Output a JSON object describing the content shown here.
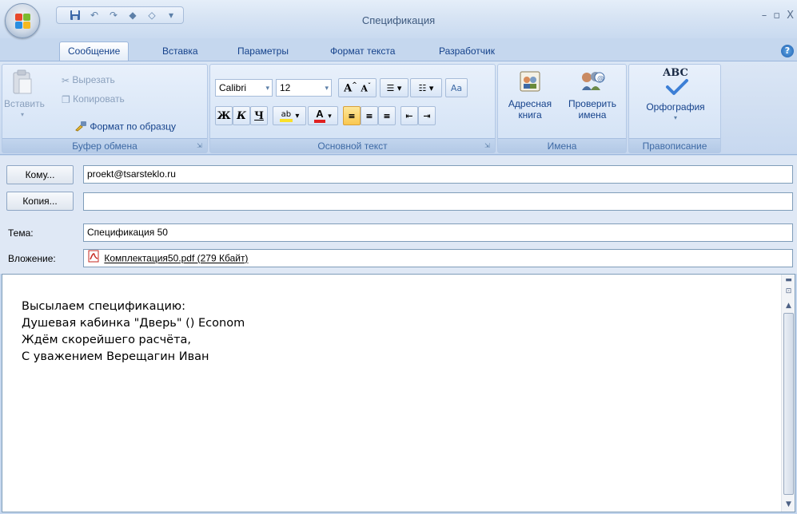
{
  "window": {
    "title": "Спецификация",
    "controls": [
      "–",
      "▫",
      "X"
    ]
  },
  "tabs": [
    {
      "label": "Сообщение",
      "active": true
    },
    {
      "label": "Вставка",
      "active": false
    },
    {
      "label": "Параметры",
      "active": false
    },
    {
      "label": "Формат текста",
      "active": false
    },
    {
      "label": "Разработчик",
      "active": false
    }
  ],
  "ribbon": {
    "clipboard": {
      "label": "Буфер обмена",
      "paste": "Вставить",
      "cut": "Вырезать",
      "copy": "Копировать",
      "format_painter": "Формат по образцу"
    },
    "basic_text": {
      "label": "Основной текст",
      "font_name": "Calibri",
      "font_size": "12",
      "bold": "Ж",
      "italic": "К",
      "underline": "Ч"
    },
    "names": {
      "label": "Имена",
      "address_book_line1": "Адресная",
      "address_book_line2": "книга",
      "check_names_line1": "Проверить",
      "check_names_line2": "имена"
    },
    "proofing": {
      "label": "Правописание",
      "spelling": "Орфография",
      "abc": "ABC"
    }
  },
  "fields": {
    "to_button": "Кому...",
    "to_value": "proekt@tsarsteklo.ru",
    "cc_button": "Копия...",
    "cc_value": "",
    "subject_label": "Тема:",
    "subject_value": "Спецификация 50",
    "attachment_label": "Вложение:",
    "attachment_value": "Комплектация50.pdf (279 Кбайт)"
  },
  "body": {
    "lines": [
      "Высылаем спецификацию:",
      "Душевая кабинка \"Дверь\" ()  Econom",
      "Ждём скорейшего расчёта,",
      "С уважением Верещагин Иван"
    ]
  },
  "colors": {
    "ribbon_text": "#15428b",
    "highlight_yellow": "#f9c74f",
    "font_color_red": "#e02020"
  }
}
